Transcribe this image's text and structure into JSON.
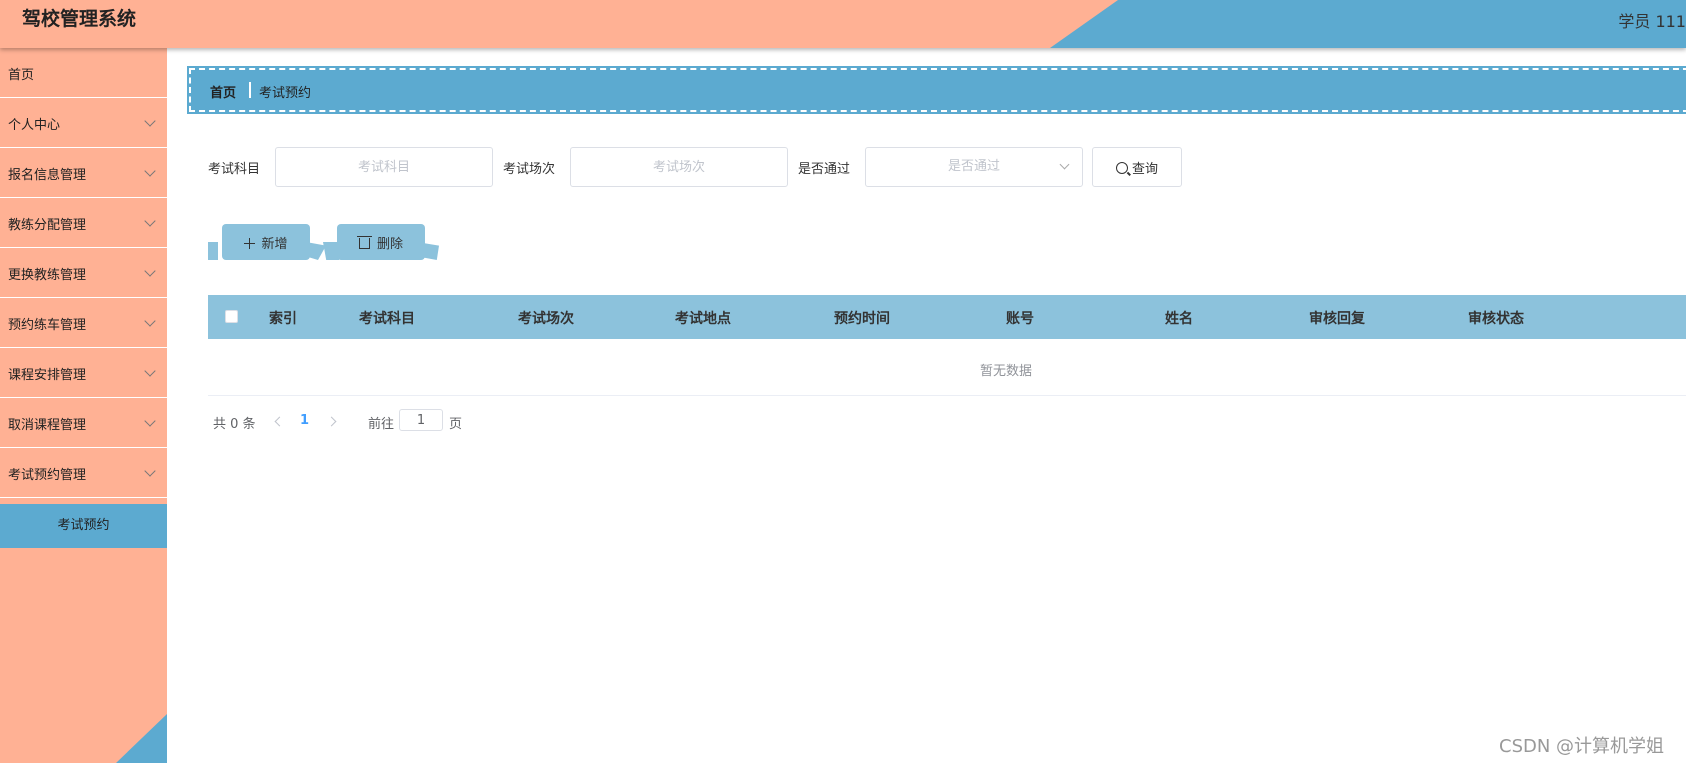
{
  "header": {
    "app_title": "驾校管理系统",
    "user_info": "学员 111"
  },
  "sidebar": {
    "items": [
      {
        "label": "首页"
      },
      {
        "label": "个人中心"
      },
      {
        "label": "报名信息管理"
      },
      {
        "label": "教练分配管理"
      },
      {
        "label": "更换教练管理"
      },
      {
        "label": "预约练车管理"
      },
      {
        "label": "课程安排管理"
      },
      {
        "label": "取消课程管理"
      },
      {
        "label": "考试预约管理"
      }
    ],
    "active_sub_item": "考试预约"
  },
  "breadcrumb": {
    "home": "首页",
    "current": "考试预约"
  },
  "filters": {
    "subject_label": "考试科目",
    "subject_placeholder": "考试科目",
    "session_label": "考试场次",
    "session_placeholder": "考试场次",
    "passed_label": "是否通过",
    "passed_placeholder": "是否通过",
    "search_button": "查询"
  },
  "actions": {
    "add_button": "新增",
    "delete_button": "删除"
  },
  "table": {
    "columns": [
      "索引",
      "考试科目",
      "考试场次",
      "考试地点",
      "预约时间",
      "账号",
      "姓名",
      "审核回复",
      "审核状态"
    ],
    "empty_text": "暂无数据"
  },
  "pagination": {
    "total": "共 0 条",
    "current_page": "1",
    "goto_label": "前往",
    "goto_value": "1",
    "page_suffix": "页"
  },
  "watermark": "CSDN @计算机学姐",
  "colors": {
    "header_bg": "#ffb194",
    "accent_blue": "#5caad0",
    "light_blue": "#8cc2dc"
  }
}
